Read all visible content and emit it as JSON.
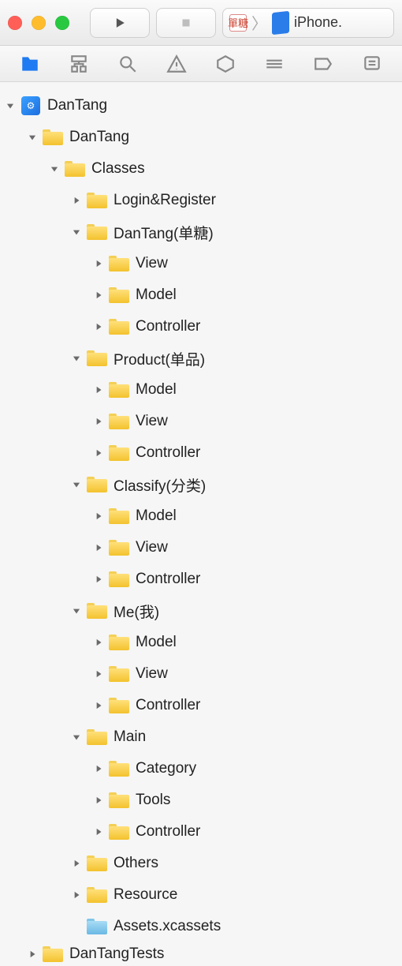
{
  "titlebar": {
    "scheme_app": "單糖",
    "scheme_device": "iPhone."
  },
  "navigator_tabs": [
    "project-navigator-icon",
    "source-control-navigator-icon",
    "find-navigator-icon",
    "issue-navigator-icon",
    "test-navigator-icon",
    "debug-navigator-icon",
    "breakpoint-navigator-icon",
    "report-navigator-icon"
  ],
  "tree": [
    {
      "depth": 0,
      "expanded": true,
      "icon": "project",
      "label": "DanTang"
    },
    {
      "depth": 1,
      "expanded": true,
      "icon": "folder",
      "label": "DanTang"
    },
    {
      "depth": 2,
      "expanded": true,
      "icon": "folder",
      "label": "Classes"
    },
    {
      "depth": 3,
      "expanded": false,
      "icon": "folder",
      "label": "Login&Register"
    },
    {
      "depth": 3,
      "expanded": true,
      "icon": "folder",
      "label": "DanTang(单糖)"
    },
    {
      "depth": 4,
      "expanded": false,
      "icon": "folder",
      "label": "View"
    },
    {
      "depth": 4,
      "expanded": false,
      "icon": "folder",
      "label": "Model"
    },
    {
      "depth": 4,
      "expanded": false,
      "icon": "folder",
      "label": "Controller"
    },
    {
      "depth": 3,
      "expanded": true,
      "icon": "folder",
      "label": "Product(单品)"
    },
    {
      "depth": 4,
      "expanded": false,
      "icon": "folder",
      "label": "Model"
    },
    {
      "depth": 4,
      "expanded": false,
      "icon": "folder",
      "label": "View"
    },
    {
      "depth": 4,
      "expanded": false,
      "icon": "folder",
      "label": "Controller"
    },
    {
      "depth": 3,
      "expanded": true,
      "icon": "folder",
      "label": "Classify(分类)"
    },
    {
      "depth": 4,
      "expanded": false,
      "icon": "folder",
      "label": "Model"
    },
    {
      "depth": 4,
      "expanded": false,
      "icon": "folder",
      "label": "View"
    },
    {
      "depth": 4,
      "expanded": false,
      "icon": "folder",
      "label": "Controller"
    },
    {
      "depth": 3,
      "expanded": true,
      "icon": "folder",
      "label": "Me(我)"
    },
    {
      "depth": 4,
      "expanded": false,
      "icon": "folder",
      "label": "Model"
    },
    {
      "depth": 4,
      "expanded": false,
      "icon": "folder",
      "label": "View"
    },
    {
      "depth": 4,
      "expanded": false,
      "icon": "folder",
      "label": "Controller"
    },
    {
      "depth": 3,
      "expanded": true,
      "icon": "folder",
      "label": "Main"
    },
    {
      "depth": 4,
      "expanded": false,
      "icon": "folder",
      "label": "Category"
    },
    {
      "depth": 4,
      "expanded": false,
      "icon": "folder",
      "label": "Tools"
    },
    {
      "depth": 4,
      "expanded": false,
      "icon": "folder",
      "label": "Controller"
    },
    {
      "depth": 3,
      "expanded": false,
      "icon": "folder",
      "label": "Others"
    },
    {
      "depth": 3,
      "expanded": false,
      "icon": "folder",
      "label": "Resource"
    },
    {
      "depth": 3,
      "expanded": null,
      "icon": "folder-blue",
      "label": "Assets.xcassets"
    },
    {
      "depth": 1,
      "expanded": false,
      "icon": "folder",
      "label": "DanTangTests",
      "cut": true
    }
  ]
}
